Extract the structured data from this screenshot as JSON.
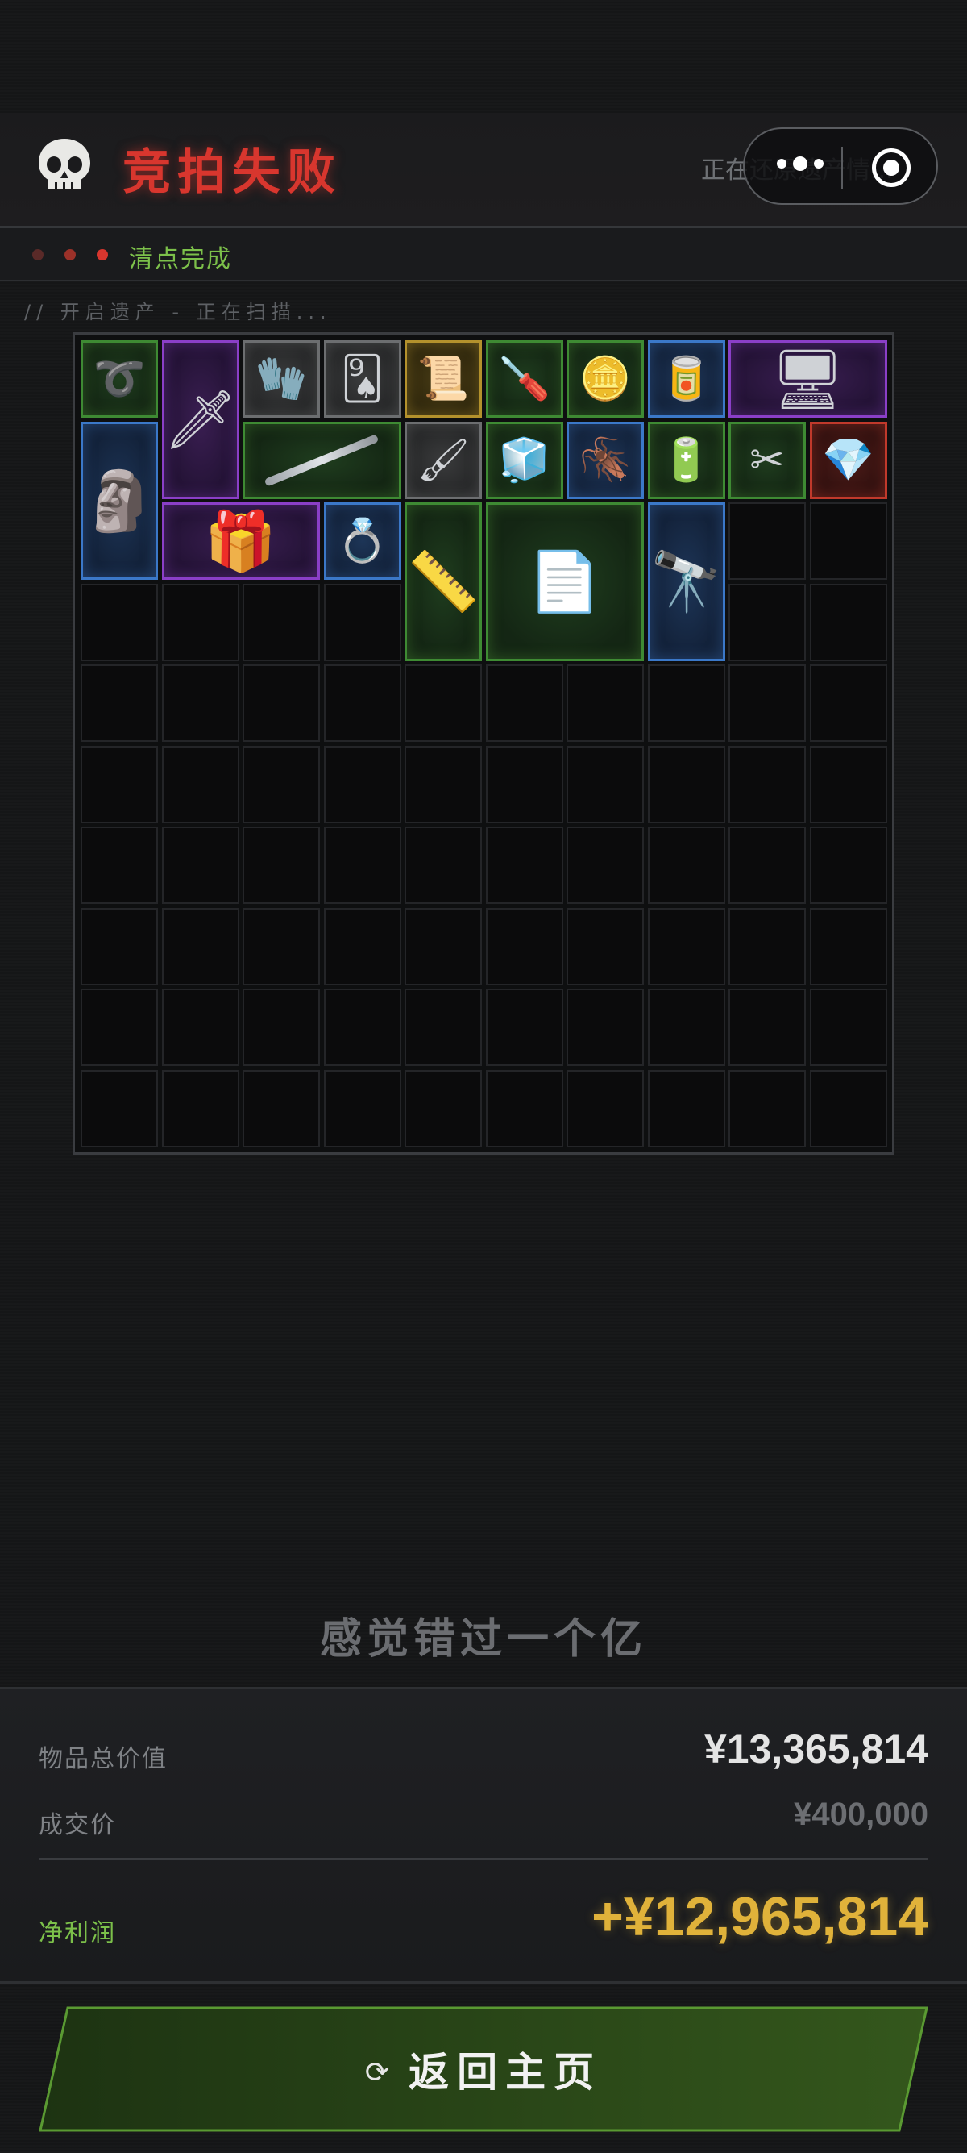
{
  "header": {
    "title": "竞拍失败",
    "status_right": "正在还原遗产情...",
    "icon": "skull-icon",
    "title_color": "#d8362e"
  },
  "substatus": {
    "label": "清点完成",
    "dot_colors": [
      "#5a2a28",
      "#9b3129",
      "#d8362e"
    ]
  },
  "scan_line": "// 开启遗产 - 正在扫描...",
  "inventory": {
    "columns": 10,
    "rows": 10,
    "items": [
      {
        "name": "rope-coil",
        "rarity": "green",
        "glyph": "➰",
        "c": 0,
        "r": 0,
        "w": 1,
        "h": 1
      },
      {
        "name": "golden-dagger",
        "rarity": "purple",
        "glyph": "🗡",
        "c": 1,
        "r": 0,
        "w": 1,
        "h": 2
      },
      {
        "name": "rubber-glove",
        "rarity": "gray",
        "glyph": "🧤",
        "c": 2,
        "r": 0,
        "w": 1,
        "h": 1
      },
      {
        "name": "playing-card",
        "rarity": "gray",
        "glyph": "🂩",
        "c": 3,
        "r": 0,
        "w": 1,
        "h": 1
      },
      {
        "name": "gold-scroll",
        "rarity": "gold",
        "glyph": "📜",
        "c": 4,
        "r": 0,
        "w": 1,
        "h": 1
      },
      {
        "name": "screwdriver",
        "rarity": "green",
        "glyph": "🪛",
        "c": 5,
        "r": 0,
        "w": 1,
        "h": 1
      },
      {
        "name": "bronze-coin",
        "rarity": "green",
        "glyph": "🪙",
        "c": 6,
        "r": 0,
        "w": 1,
        "h": 1
      },
      {
        "name": "soda-can",
        "rarity": "blue",
        "glyph": "🥫",
        "c": 7,
        "r": 0,
        "w": 1,
        "h": 1
      },
      {
        "name": "circuit-board",
        "rarity": "purple",
        "glyph": "🖥",
        "c": 8,
        "r": 0,
        "w": 2,
        "h": 1
      },
      {
        "name": "statue",
        "rarity": "blue",
        "glyph": "🗿",
        "c": 0,
        "r": 1,
        "w": 1,
        "h": 2
      },
      {
        "name": "metal-rod",
        "rarity": "green",
        "glyph": "",
        "c": 2,
        "r": 1,
        "w": 2,
        "h": 1
      },
      {
        "name": "paint-brush",
        "rarity": "gray",
        "glyph": "🖌",
        "c": 4,
        "r": 1,
        "w": 1,
        "h": 1
      },
      {
        "name": "crystal-box",
        "rarity": "green",
        "glyph": "🧊",
        "c": 5,
        "r": 1,
        "w": 1,
        "h": 1
      },
      {
        "name": "cockroach",
        "rarity": "blue",
        "glyph": "🪳",
        "c": 6,
        "r": 1,
        "w": 1,
        "h": 1
      },
      {
        "name": "batteries",
        "rarity": "green",
        "glyph": "🔋",
        "c": 7,
        "r": 1,
        "w": 1,
        "h": 1
      },
      {
        "name": "pliers",
        "rarity": "green",
        "glyph": "✂",
        "c": 8,
        "r": 1,
        "w": 1,
        "h": 1
      },
      {
        "name": "diamond",
        "rarity": "red",
        "glyph": "💎",
        "c": 9,
        "r": 1,
        "w": 1,
        "h": 1
      },
      {
        "name": "edc-pack",
        "rarity": "purple",
        "glyph": "🎁",
        "c": 1,
        "r": 2,
        "w": 2,
        "h": 1
      },
      {
        "name": "metal-bracelet",
        "rarity": "blue",
        "glyph": "💍",
        "c": 3,
        "r": 2,
        "w": 1,
        "h": 1
      },
      {
        "name": "spirit-level",
        "rarity": "green",
        "glyph": "📏",
        "c": 4,
        "r": 2,
        "w": 1,
        "h": 2
      },
      {
        "name": "drawings",
        "rarity": "green",
        "glyph": "📄",
        "c": 5,
        "r": 2,
        "w": 2,
        "h": 2
      },
      {
        "name": "telescope",
        "rarity": "blue",
        "glyph": "🔭",
        "c": 7,
        "r": 2,
        "w": 1,
        "h": 2
      }
    ],
    "rarity_colors": {
      "green": "#3e8a33",
      "purple": "#8a3fc7",
      "blue": "#3b78c8",
      "gray": "#6c6e70",
      "gold": "#b3912c",
      "red": "#c0392b"
    }
  },
  "tagline": "感觉错过一个亿",
  "summary": {
    "total_label": "物品总价值",
    "total_value": "¥13,365,814",
    "deal_label": "成交价",
    "deal_value": "¥400,000",
    "profit_label": "净利润",
    "profit_value": "+¥12,965,814",
    "profit_color": "#e0b23a",
    "profit_label_color": "#7cc04a"
  },
  "button": {
    "label": "返回主页",
    "icon": "refresh-icon",
    "icon_glyph": "⟳"
  }
}
